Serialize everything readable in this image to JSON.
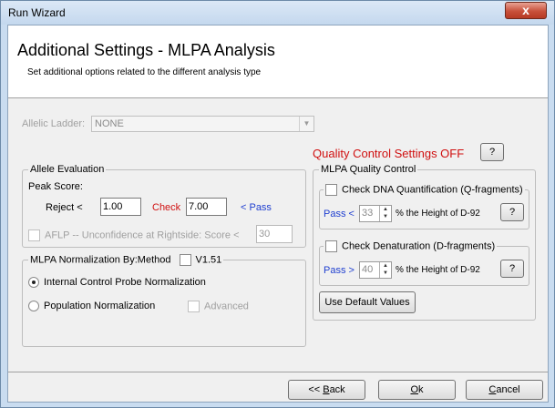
{
  "window": {
    "title": "Run Wizard",
    "close_glyph": "x"
  },
  "header": {
    "title": "Additional Settings - MLPA Analysis",
    "subtitle": "Set additional options related to the different analysis type"
  },
  "allelic_ladder": {
    "label": "Allelic Ladder:",
    "value": "NONE"
  },
  "qc_settings": {
    "label": "Quality Control Settings OFF",
    "help_label": "?"
  },
  "allele_evaluation": {
    "legend": "Allele Evaluation",
    "peak_score_label": "Peak Score:",
    "reject_label": "Reject  <",
    "reject_value": "1.00",
    "check_label": "Check",
    "check_value": "7.00",
    "pass_label": "< Pass",
    "aflp_label": "AFLP -- Unconfidence at Rightside:  Score <",
    "aflp_value": "30"
  },
  "normalization": {
    "legend": "MLPA Normalization By:Method",
    "version_label": "V1.51",
    "internal_label": "Internal Control Probe Normalization",
    "population_label": "Population Normalization",
    "advanced_label": "Advanced"
  },
  "mlpa_qc": {
    "legend": "MLPA Quality Control",
    "dna_quant": {
      "legend": "Check DNA Quantification (Q-fragments)",
      "pass_label": "Pass <",
      "value": "33",
      "suffix": "% the Height of D-92",
      "help_label": "?"
    },
    "denaturation": {
      "legend": "Check Denaturation (D-fragments)",
      "pass_label": "Pass >",
      "value": "40",
      "suffix": "% the Height of D-92",
      "help_label": "?"
    },
    "default_button": "Use Default Values"
  },
  "footer": {
    "back_button": {
      "prefix": "<< ",
      "mnemonic": "B",
      "rest": "ack"
    },
    "ok_button": {
      "mnemonic": "O",
      "rest": "k"
    },
    "cancel_button": {
      "mnemonic": "C",
      "rest": "ancel"
    }
  },
  "colors": {
    "accent_red": "#d01010",
    "link_blue": "#1f3fd0",
    "title_bar": "#c9dcf0"
  }
}
